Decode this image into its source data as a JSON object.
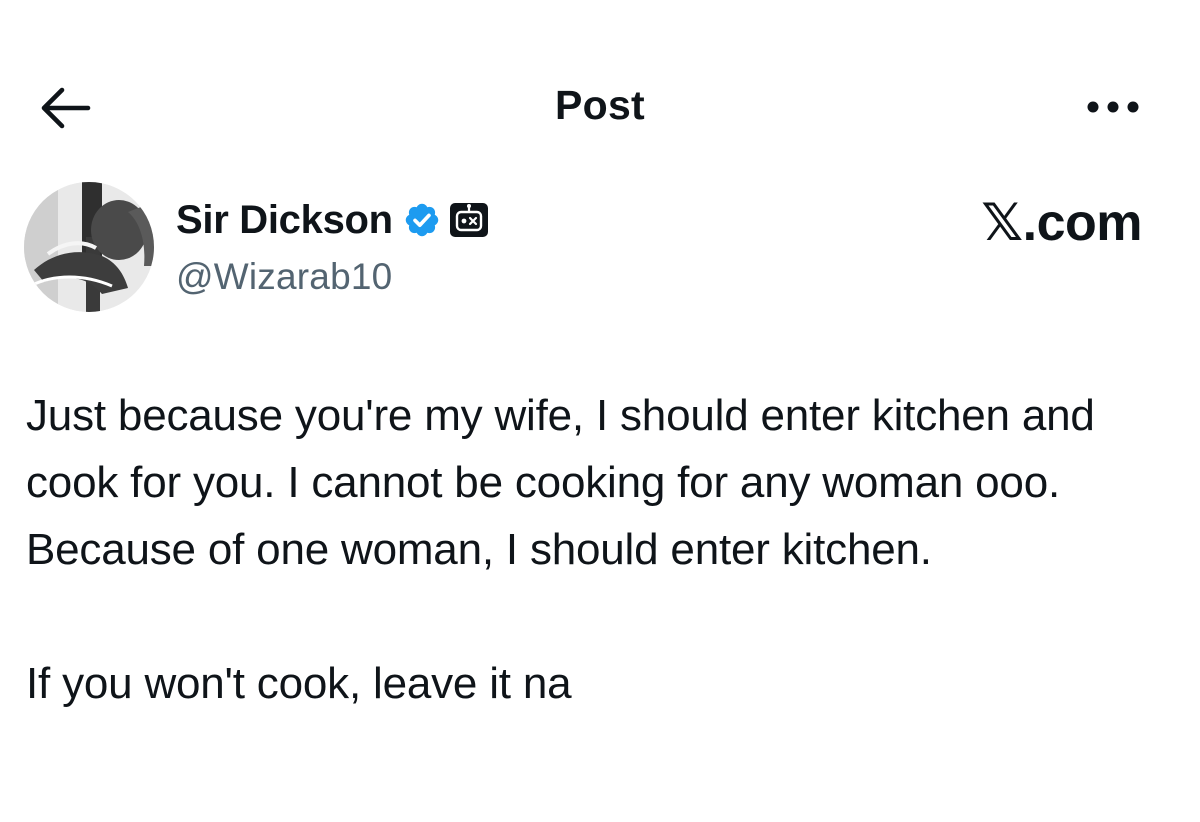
{
  "header": {
    "title": "Post",
    "back_icon": "arrow-left-icon",
    "more_icon": "more-horizontal-icon"
  },
  "author": {
    "display_name": "Sir Dickson",
    "handle": "@Wizarab10",
    "verified_icon": "verified-badge-icon",
    "automated_icon": "automated-account-icon",
    "badge_color": "#1d9bf0"
  },
  "site_mark": "𝕏.com",
  "post": {
    "paragraphs": [
      "Just because you're my wife, I should enter kitchen and cook for you. I cannot be cooking for any woman ooo. Because of one woman, I should enter kitchen.",
      "If you won't cook, leave it na"
    ]
  },
  "colors": {
    "text": "#0f1419",
    "secondary_text": "#536471",
    "background": "#ffffff"
  }
}
